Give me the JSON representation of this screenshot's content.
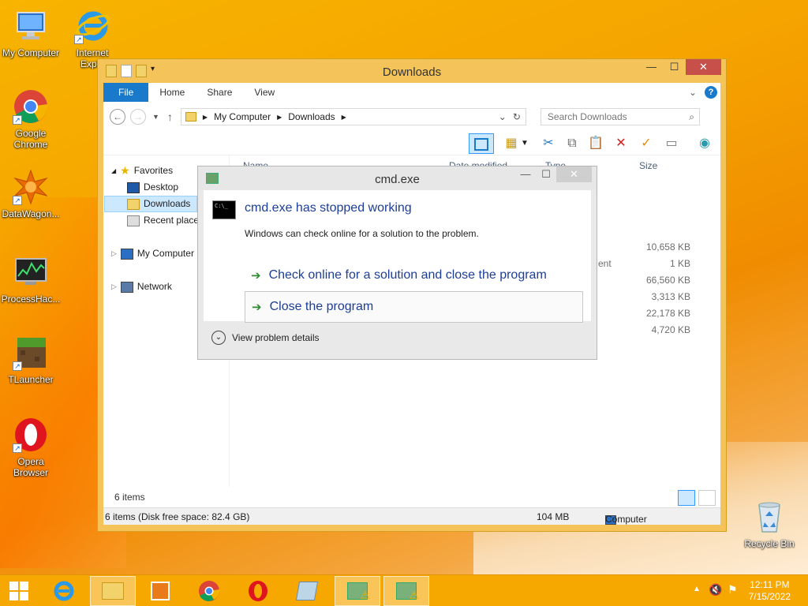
{
  "desktop": {
    "icons": [
      {
        "label": "My Computer"
      },
      {
        "label": "Internet Explo"
      },
      {
        "label": "Google Chrome"
      },
      {
        "label": "DataWagon..."
      },
      {
        "label": "ProcessHac..."
      },
      {
        "label": "TLauncher"
      },
      {
        "label": "Opera Browser"
      },
      {
        "label": "Recycle Bin"
      }
    ]
  },
  "explorer": {
    "title": "Downloads",
    "tabs": [
      "File",
      "Home",
      "Share",
      "View"
    ],
    "breadcrumb": [
      "My Computer",
      "Downloads"
    ],
    "search_placeholder": "Search Downloads",
    "nav": {
      "favorites": "Favorites",
      "desktop": "Desktop",
      "downloads": "Downloads",
      "recent": "Recent places",
      "computer": "My Computer",
      "network": "Network"
    },
    "columns": {
      "name": "Name",
      "date": "Date modified",
      "type": "Type",
      "size": "Size"
    },
    "partial_type": "ent",
    "sizes": [
      "10,658 KB",
      "1 KB",
      "66,560 KB",
      "3,313 KB",
      "22,178 KB",
      "4,720 KB"
    ],
    "item_count": "6 items",
    "status": {
      "left": "6 items (Disk free space: 82.4 GB)",
      "mid": "104 MB",
      "right": "Computer"
    }
  },
  "dialog": {
    "title": "cmd.exe",
    "heading": "cmd.exe has stopped working",
    "subtext": "Windows can check online for a solution to the problem.",
    "option1": "Check online for a solution and close the program",
    "option2": "Close the program",
    "details": "View problem details",
    "icon_text": "C:\\_"
  },
  "taskbar": {
    "time": "12:11 PM",
    "date": "7/15/2022"
  },
  "colors": {
    "accent": "#1979ca",
    "link": "#1c3e96",
    "taskbar": "#f6a700"
  }
}
